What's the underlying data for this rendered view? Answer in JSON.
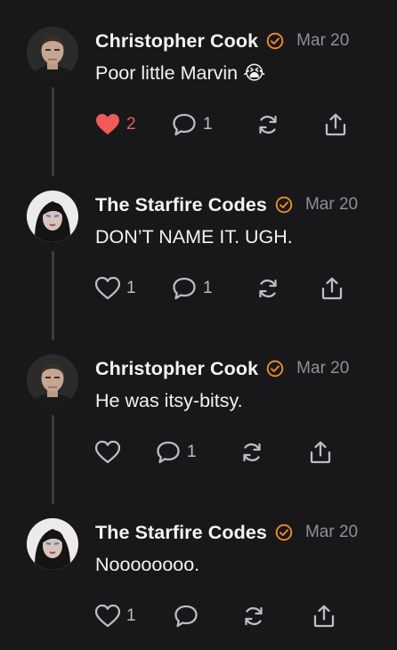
{
  "colors": {
    "background": "#18181a",
    "accent_orange": "#f08c2c",
    "like_red": "#f25a5a",
    "muted": "#8f8f94"
  },
  "posts": [
    {
      "author": "Christopher Cook",
      "date": "Mar 20",
      "text": "Poor little Marvin 😭",
      "likes": "2",
      "liked": true,
      "comments": "1",
      "avatar": "man-avatar",
      "icons": [
        "heart-icon",
        "comment-icon",
        "repost-icon",
        "share-icon",
        "verified-badge-icon"
      ]
    },
    {
      "author": "The Starfire Codes",
      "date": "Mar 20",
      "text": "DON’T NAME IT. UGH.",
      "likes": "1",
      "liked": false,
      "comments": "1",
      "avatar": "woman-avatar"
    },
    {
      "author": "Christopher Cook",
      "date": "Mar 20",
      "text": "He was itsy-bitsy.",
      "likes": "",
      "liked": false,
      "comments": "1",
      "avatar": "man-avatar"
    },
    {
      "author": "The Starfire Codes",
      "date": "Mar 20",
      "text": "Noooooooo.",
      "likes": "1",
      "liked": false,
      "comments": "",
      "avatar": "woman-avatar"
    }
  ]
}
